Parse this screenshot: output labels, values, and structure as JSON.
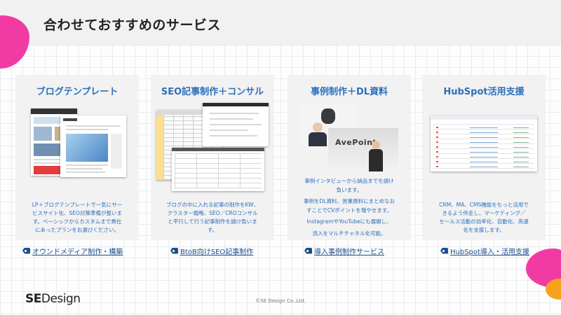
{
  "header": {
    "title": "合わせておすすめのサービス"
  },
  "cards": [
    {
      "title": "ブログテンプレート",
      "desc_lines": [
        "LP＋ブログテンプレートで一気にサー",
        "ビスサイト化、SEO対策準備が整いま",
        "す。ベーシックからカスタムまで貴社",
        "にあったプランをお選びください。"
      ],
      "link": "オウンドメディア制作・構築"
    },
    {
      "title": "SEO記事制作＋コンサル",
      "desc_lines": [
        "ブログの中に入れる記事の制作をKW、",
        "クラスター戦略、SEO／CROコンサル",
        "と平行して行う記事制作を請け負いま",
        "す。"
      ],
      "link": "BtoB向けSEO記事制作"
    },
    {
      "title": "事例制作＋DL資料",
      "desc_lines": [
        "事例インタビューから納品までを請け",
        "負います。",
        "事例をDL資料、営業資料にまとめなお",
        "すことでCVポイントを増やせます。",
        "InstagramやYouTubeにも展開し、",
        "流入をマルチチャネル化可能。"
      ],
      "link": "導入事例制作サービス",
      "photo_sign": "AvePoint"
    },
    {
      "title": "HubSpot活用支援",
      "desc_lines": [
        "CRM、MA、CMS機能をもっと活用で",
        "きるよう伴走し、マーケティング／",
        "セールス活動の効率化、自動化、高速",
        "化を支援します。"
      ],
      "link": "HubSpot導入・活用支援"
    }
  ],
  "footer": {
    "logo_bold": "SE",
    "logo_light": "Design",
    "copyright": "©SE Design Co.,Ltd."
  },
  "colors": {
    "accent_blue": "#2c6fbb",
    "link_blue": "#1f4e8c",
    "pink": "#f13ba3",
    "orange": "#f7a21e"
  },
  "icons": {
    "link_icon": "tag-icon"
  }
}
